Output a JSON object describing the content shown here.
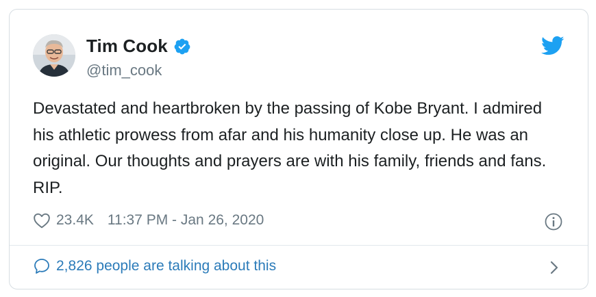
{
  "author": {
    "name": "Tim Cook",
    "handle": "@tim_cook",
    "verified": true,
    "avatar_icon": "avatar-photo"
  },
  "tweet": {
    "text": "Devastated and heartbroken by the passing of Kobe Bryant. I admired his athletic prowess from afar and his humanity close up. He was an original. Our thoughts and prayers are with his family, friends and fans. RIP.",
    "likes": "23.4K",
    "timestamp": "11:37 PM - Jan 26, 2020"
  },
  "footer": {
    "conversation_text": "2,826 people are talking about this"
  },
  "icons": {
    "brand": "twitter-bird-icon",
    "like": "heart-icon",
    "info": "info-icon",
    "reply": "comment-bubble-icon",
    "more": "chevron-right-icon"
  },
  "colors": {
    "brand": "#1da1f2",
    "link": "#2b7bb9",
    "muted": "#697882",
    "text": "#1c2022",
    "border": "#d6dde2"
  }
}
